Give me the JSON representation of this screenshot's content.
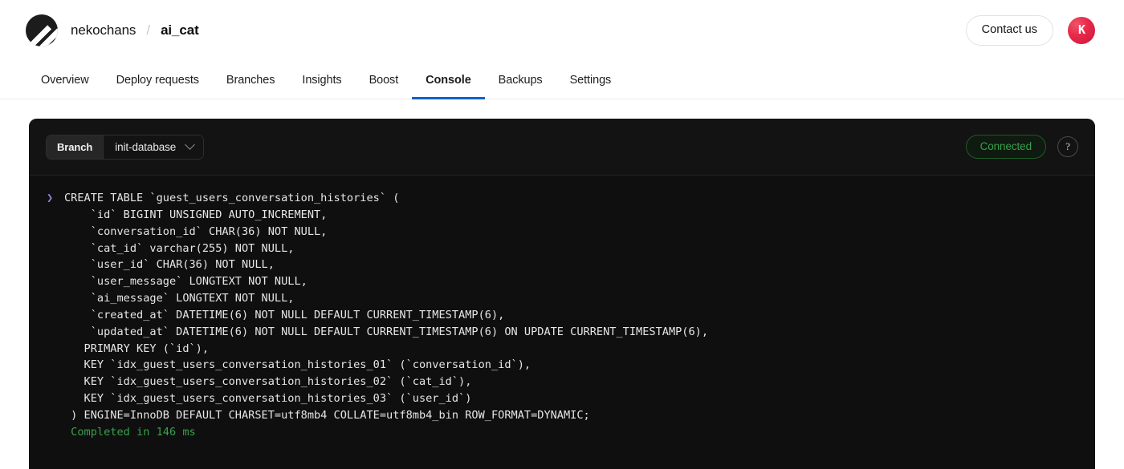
{
  "header": {
    "logo_icon": "planetscale-logo-icon",
    "breadcrumb": {
      "org": "nekochans",
      "separator": "/",
      "database": "ai_cat"
    },
    "contact_label": "Contact us",
    "avatar_letter": "K"
  },
  "nav": {
    "accent_color": "#0b63ce",
    "tabs": [
      {
        "label": "Overview",
        "active": false
      },
      {
        "label": "Deploy requests",
        "active": false
      },
      {
        "label": "Branches",
        "active": false
      },
      {
        "label": "Insights",
        "active": false
      },
      {
        "label": "Boost",
        "active": false
      },
      {
        "label": "Console",
        "active": true
      },
      {
        "label": "Backups",
        "active": false
      },
      {
        "label": "Settings",
        "active": false
      }
    ]
  },
  "console": {
    "branch_label": "Branch",
    "branch_value": "init-database",
    "branch_chevron_icon": "chevron-down-icon",
    "status": "Connected",
    "status_color": "#37a24a",
    "help_icon": "question-mark-icon",
    "prompt_symbol": "❯",
    "prompt_color": "#9183e0",
    "lines": [
      {
        "prompt": true,
        "text": "CREATE TABLE `guest_users_conversation_histories` ("
      },
      {
        "prompt": false,
        "text": "    `id` BIGINT UNSIGNED AUTO_INCREMENT,"
      },
      {
        "prompt": false,
        "text": "    `conversation_id` CHAR(36) NOT NULL,"
      },
      {
        "prompt": false,
        "text": "    `cat_id` varchar(255) NOT NULL,"
      },
      {
        "prompt": false,
        "text": "    `user_id` CHAR(36) NOT NULL,"
      },
      {
        "prompt": false,
        "text": "    `user_message` LONGTEXT NOT NULL,"
      },
      {
        "prompt": false,
        "text": "    `ai_message` LONGTEXT NOT NULL,"
      },
      {
        "prompt": false,
        "text": "    `created_at` DATETIME(6) NOT NULL DEFAULT CURRENT_TIMESTAMP(6),"
      },
      {
        "prompt": false,
        "text": "    `updated_at` DATETIME(6) NOT NULL DEFAULT CURRENT_TIMESTAMP(6) ON UPDATE CURRENT_TIMESTAMP(6),"
      },
      {
        "prompt": false,
        "text": "   PRIMARY KEY (`id`),"
      },
      {
        "prompt": false,
        "text": "   KEY `idx_guest_users_conversation_histories_01` (`conversation_id`),"
      },
      {
        "prompt": false,
        "text": "   KEY `idx_guest_users_conversation_histories_02` (`cat_id`),"
      },
      {
        "prompt": false,
        "text": "   KEY `idx_guest_users_conversation_histories_03` (`user_id`)"
      },
      {
        "prompt": false,
        "text": " ) ENGINE=InnoDB DEFAULT CHARSET=utf8mb4 COLLATE=utf8mb4_bin ROW_FORMAT=DYNAMIC;"
      },
      {
        "prompt": false,
        "text": " Completed in 146 ms",
        "status": "ok"
      }
    ]
  }
}
